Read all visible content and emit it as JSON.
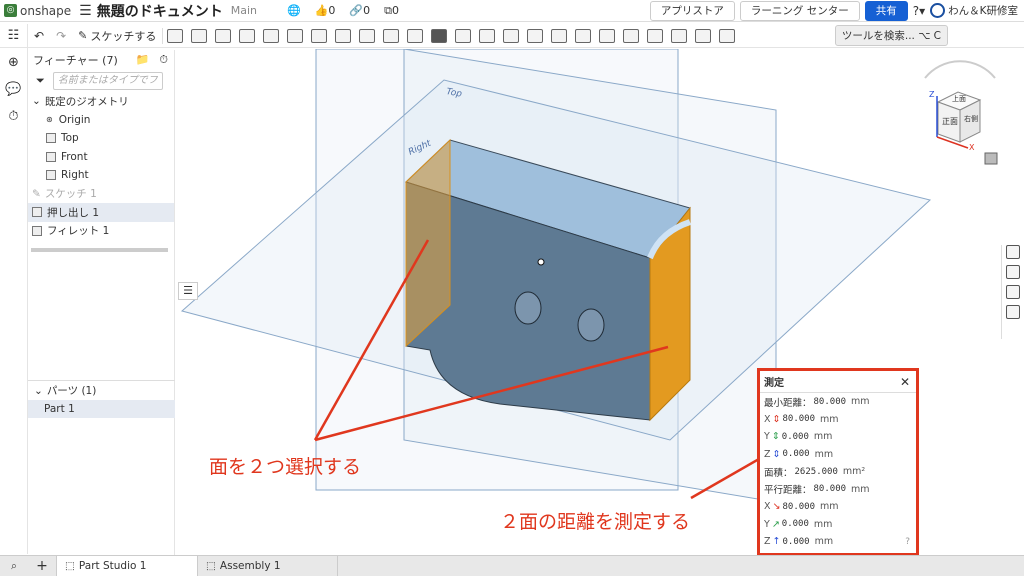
{
  "app": {
    "logo": "onshape",
    "doc_title": "無題のドキュメント",
    "branch": "Main",
    "likes": "0",
    "links": "0",
    "copies": "0",
    "buttons": {
      "app_store": "アプリストア",
      "learning": "ラーニング センター",
      "share": "共有"
    },
    "user": "わん＆K研修室"
  },
  "toolbar": {
    "sketch_label": "スケッチする",
    "search_tools": "ツールを検索...",
    "shortcut": "⌥ C"
  },
  "panel": {
    "features_header": "フィーチャー (7)",
    "filter_placeholder": "名前またはタイプでフ",
    "default_geometry": "既定のジオメトリ",
    "items": [
      "Origin",
      "Top",
      "Front",
      "Right"
    ],
    "sketch1": "スケッチ 1",
    "extrude1": "押し出し 1",
    "fillet1": "フィレット 1",
    "parts_header": "パーツ (1)",
    "part1": "Part 1"
  },
  "tabs": {
    "part_studio": "Part Studio 1",
    "assembly": "Assembly 1"
  },
  "viewport": {
    "plane_top": "Top",
    "plane_right": "Right"
  },
  "viewcube": {
    "top": "上面",
    "front": "正面",
    "right": "右側",
    "z": "Z",
    "x": "X"
  },
  "measure": {
    "title": "測定",
    "min_distance_label": "最小距離：",
    "min_distance": "80.000",
    "dx": "80.000",
    "dy": "0.000",
    "dz": "0.000",
    "area_label": "面積：",
    "area": "2625.000",
    "area_unit": "mm²",
    "parallel_label": "平行距離：",
    "parallel": "80.000",
    "px": "80.000",
    "py": "0.000",
    "pz": "0.000",
    "unit": "mm",
    "axis_x": "X",
    "axis_y": "Y",
    "axis_z": "Z"
  },
  "annotations": {
    "select_faces": "面を２つ選択する",
    "measure_distance": "２面の距離を測定する"
  },
  "colors": {
    "accent_red": "#e0371e",
    "share_blue": "#1560d4",
    "face_orange": "#e39a20",
    "face_blue": "#8fb3d6"
  }
}
